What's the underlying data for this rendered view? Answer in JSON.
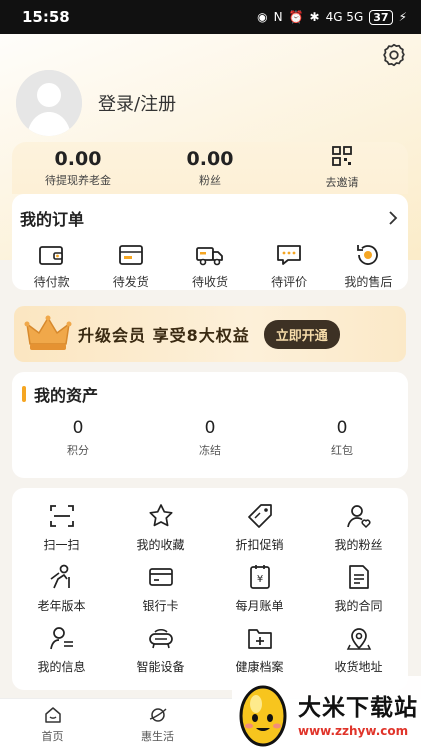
{
  "status_bar": {
    "time": "15:58",
    "signal_text": "4G 5G",
    "battery": "37"
  },
  "profile": {
    "login_label": "登录/注册"
  },
  "stats": [
    {
      "value": "0.00",
      "label": "待提现养老金"
    },
    {
      "value": "0.00",
      "label": "粉丝"
    },
    {
      "label": "去邀请",
      "icon": "qr-code-icon"
    }
  ],
  "orders": {
    "title": "我的订单",
    "items": [
      {
        "label": "待付款",
        "icon": "wallet-icon"
      },
      {
        "label": "待发货",
        "icon": "box-icon"
      },
      {
        "label": "待收货",
        "icon": "truck-icon"
      },
      {
        "label": "待评价",
        "icon": "comment-icon"
      },
      {
        "label": "我的售后",
        "icon": "refund-icon"
      }
    ]
  },
  "vip": {
    "text": "升级会员 享受8大权益",
    "button": "立即开通"
  },
  "assets": {
    "title": "我的资产",
    "items": [
      {
        "value": "0",
        "label": "积分"
      },
      {
        "value": "0",
        "label": "冻结"
      },
      {
        "value": "0",
        "label": "红包"
      }
    ]
  },
  "tools": [
    {
      "label": "扫一扫",
      "icon": "scan-icon"
    },
    {
      "label": "我的收藏",
      "icon": "star-icon"
    },
    {
      "label": "折扣促销",
      "icon": "tag-icon"
    },
    {
      "label": "我的粉丝",
      "icon": "fans-icon"
    },
    {
      "label": "老年版本",
      "icon": "elder-icon"
    },
    {
      "label": "银行卡",
      "icon": "card-icon"
    },
    {
      "label": "每月账单",
      "icon": "bill-icon"
    },
    {
      "label": "我的合同",
      "icon": "contract-icon"
    },
    {
      "label": "我的信息",
      "icon": "user-info-icon"
    },
    {
      "label": "智能设备",
      "icon": "device-icon"
    },
    {
      "label": "健康档案",
      "icon": "health-folder-icon"
    },
    {
      "label": "收货地址",
      "icon": "location-icon"
    }
  ],
  "tabbar": [
    {
      "label": "首页",
      "icon": "home-icon"
    },
    {
      "label": "惠生活",
      "icon": "planet-icon"
    }
  ],
  "watermark": {
    "title": "大米下载站",
    "url": "www.zzhyw.com"
  },
  "colors": {
    "accent": "#f5a623",
    "vip_button": "#3d3124",
    "watermark_url": "#e0342a"
  }
}
